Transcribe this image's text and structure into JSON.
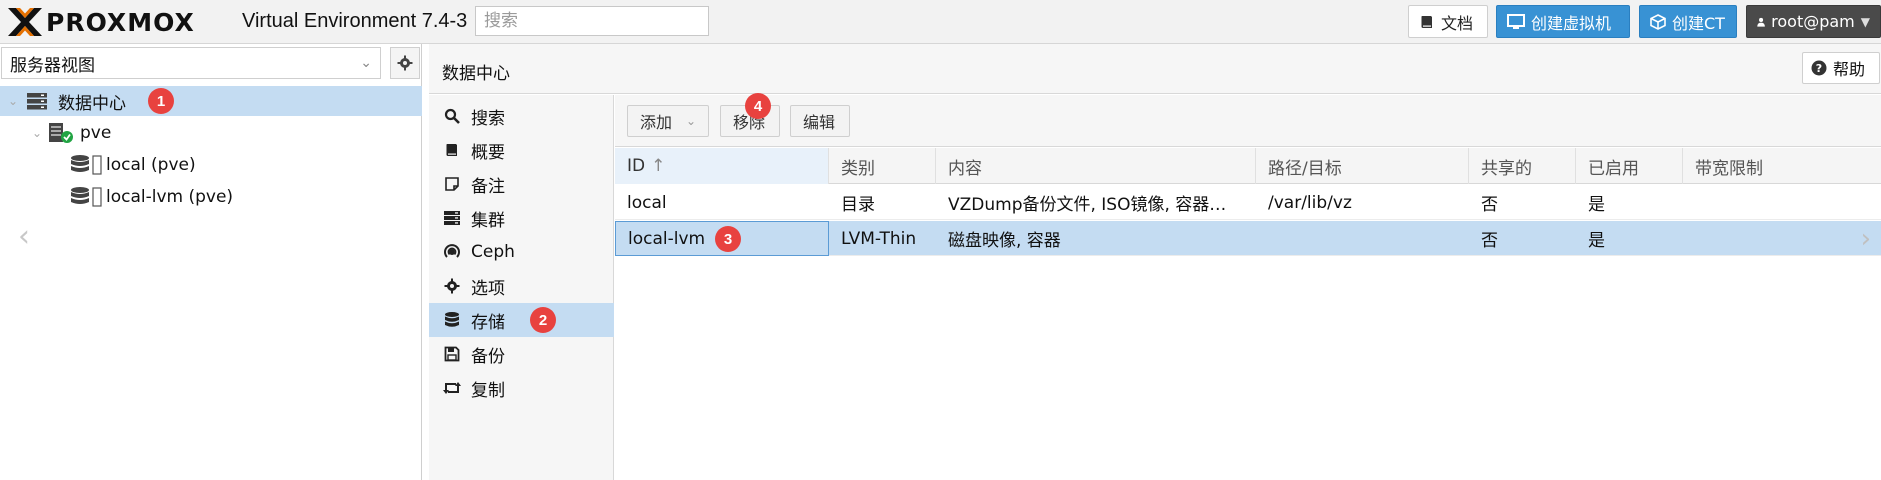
{
  "app": {
    "brand": "PROXMOX",
    "version": "Virtual Environment 7.4-3",
    "search_placeholder": "搜索"
  },
  "header_buttons": {
    "docs": "文档",
    "create_vm": "创建虚拟机",
    "create_ct": "创建CT",
    "user": "root@pam"
  },
  "left": {
    "view_select": "服务器视图",
    "tree": [
      {
        "label": "数据中心",
        "level": 0,
        "selected": true
      },
      {
        "label": "pve",
        "level": 1
      },
      {
        "label": "local (pve)",
        "level": 2
      },
      {
        "label": "local-lvm (pve)",
        "level": 2
      }
    ]
  },
  "main": {
    "title": "数据中心",
    "help": "帮助",
    "nav": [
      {
        "label": "搜索",
        "icon": "search-icon"
      },
      {
        "label": "概要",
        "icon": "book-icon"
      },
      {
        "label": "备注",
        "icon": "note-icon"
      },
      {
        "label": "集群",
        "icon": "server-icon"
      },
      {
        "label": "Ceph",
        "icon": "ceph-icon"
      },
      {
        "label": "选项",
        "icon": "gear-icon"
      },
      {
        "label": "存储",
        "icon": "database-icon",
        "active": true
      },
      {
        "label": "备份",
        "icon": "floppy-icon"
      },
      {
        "label": "复制",
        "icon": "retweet-icon"
      }
    ],
    "toolbar": {
      "add": "添加",
      "remove": "移除",
      "edit": "编辑"
    },
    "columns": [
      "ID",
      "类别",
      "内容",
      "路径/目标",
      "共享的",
      "已启用",
      "带宽限制"
    ],
    "rows": [
      {
        "id": "local",
        "type": "目录",
        "content": "VZDump备份文件, ISO镜像, 容器…",
        "path": "/var/lib/vz",
        "shared": "否",
        "enabled": "是",
        "bw": ""
      },
      {
        "id": "local-lvm",
        "type": "LVM-Thin",
        "content": "磁盘映像, 容器",
        "path": "",
        "shared": "否",
        "enabled": "是",
        "bw": "",
        "selected": true
      }
    ]
  },
  "markers": {
    "m1": "1",
    "m2": "2",
    "m3": "3",
    "m4": "4"
  },
  "colors": {
    "accent": "#3892d4",
    "selection": "#c4dcf2",
    "marker": "#e8423f",
    "logo_orange": "#e57000"
  }
}
